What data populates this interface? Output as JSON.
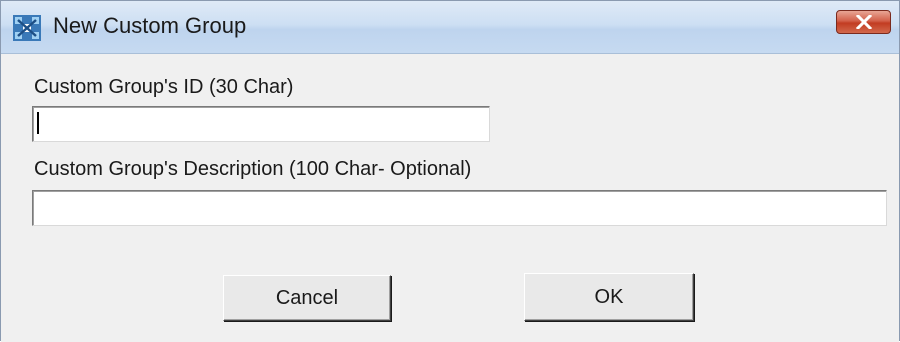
{
  "window": {
    "title": "New Custom Group",
    "icon": "custom-group-app-icon",
    "close_icon": "close-icon"
  },
  "form": {
    "id_label": "Custom Group's ID (30 Char)",
    "id_value": "",
    "description_label": "Custom Group's Description (100 Char- Optional)",
    "description_value": ""
  },
  "buttons": {
    "cancel_label": "Cancel",
    "ok_label": "OK"
  },
  "colors": {
    "close_button": "#c23c22",
    "titlebar": "#cddff3",
    "client_background": "#f0f0f0"
  }
}
